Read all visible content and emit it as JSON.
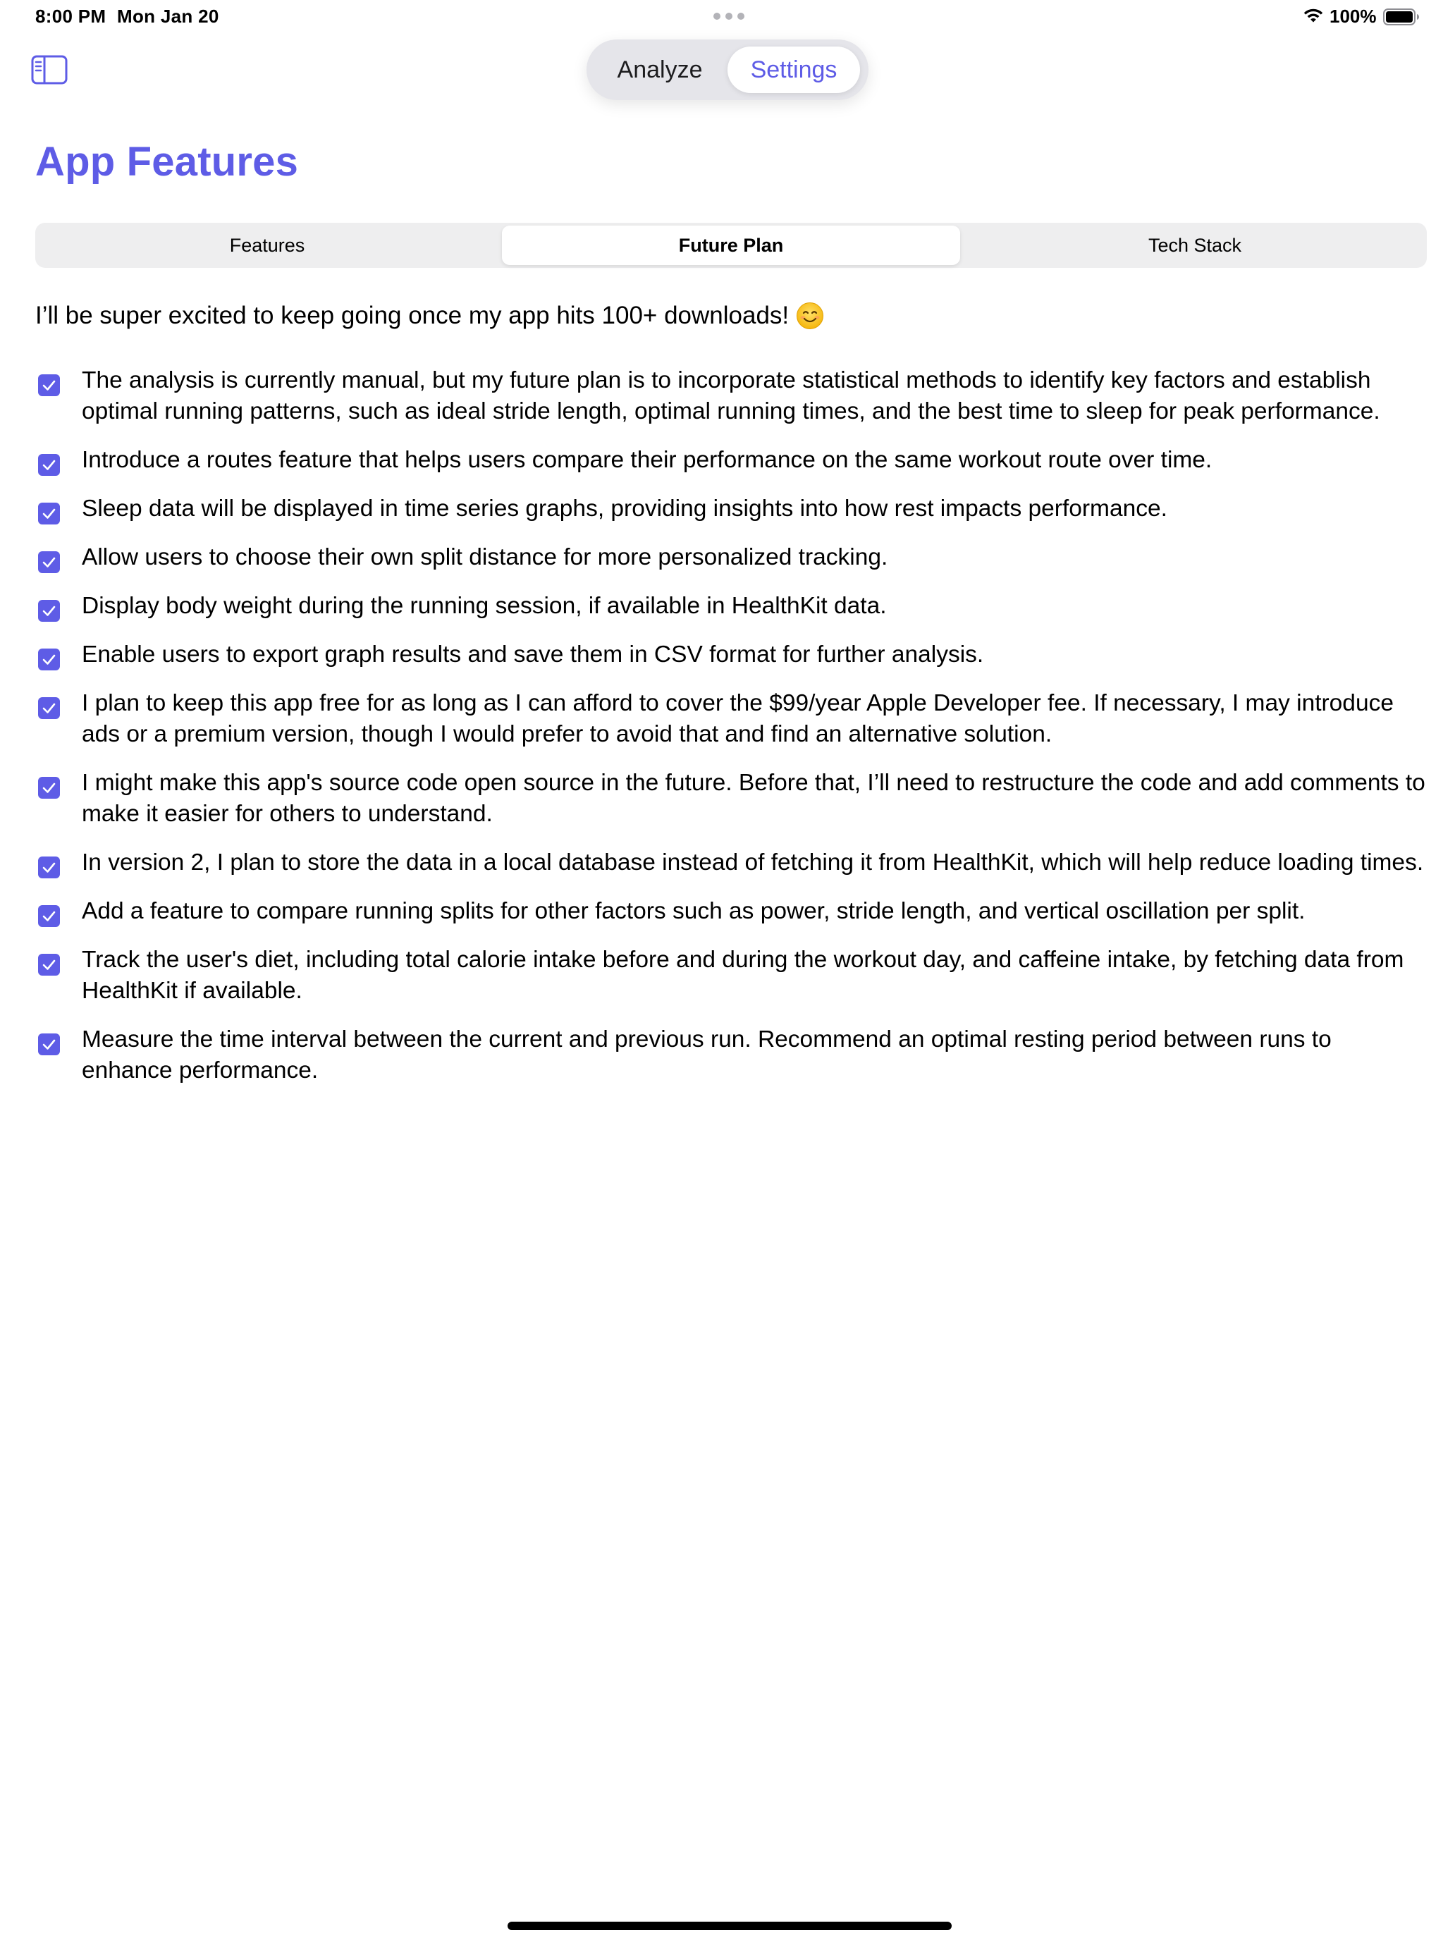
{
  "status_bar": {
    "time": "8:00 PM",
    "date": "Mon Jan 20",
    "battery": "100%",
    "icons": [
      "multitask-dots-icon",
      "wifi-icon",
      "battery-icon"
    ]
  },
  "nav": {
    "sidebar_icon": "sidebar-toggle-icon",
    "segments": [
      "Analyze",
      "Settings"
    ],
    "selected_segment": "Settings"
  },
  "page": {
    "title": "App Features"
  },
  "sub_tabs": {
    "labels": [
      "Features",
      "Future Plan",
      "Tech Stack"
    ],
    "selected": "Future Plan"
  },
  "intro": {
    "text": "I’ll be super excited to keep going once my app hits 100+ downloads!",
    "emoji_icon": "smiling-face-icon"
  },
  "plan_items": [
    "The analysis is currently manual, but my future plan is to incorporate statistical methods to identify key factors and establish optimal running patterns, such as ideal stride length, optimal running times, and the best time to sleep for peak performance.",
    "Introduce a routes feature that helps users compare their performance on the same workout route over time.",
    "Sleep data will be displayed in time series graphs, providing insights into how rest impacts performance.",
    "Allow users to choose their own split distance for more personalized tracking.",
    "Display body weight during the running session, if available in HealthKit data.",
    "Enable users to export graph results and save them in CSV format for further analysis.",
    "I plan to keep this app free for as long as I can afford to cover the $99/year Apple Developer fee. If necessary, I may introduce ads or a premium version, though I would prefer to avoid that and find an alternative solution.",
    "I might make this app's source code open source in the future. Before that, I’ll need to restructure the code and add comments to make it easier for others to understand.",
    "In version 2, I plan to store the data in a local database instead of fetching it from HealthKit, which will help reduce loading times.",
    "Add a feature to compare running splits for other factors such as power, stride length, and vertical oscillation per split.",
    "Track the user's diet, including total calorie intake before and during the workout day, and caffeine intake, by fetching data from HealthKit if available.",
    "Measure the time interval between the current and previous run. Recommend an optimal resting period between runs to enhance performance."
  ],
  "checkbox_state": "checked",
  "colors": {
    "accent": "#5e5ce6",
    "segment_bg": "#e5e5ea",
    "sub_segment_bg": "#eeeeef",
    "text": "#000000",
    "background": "#ffffff"
  }
}
